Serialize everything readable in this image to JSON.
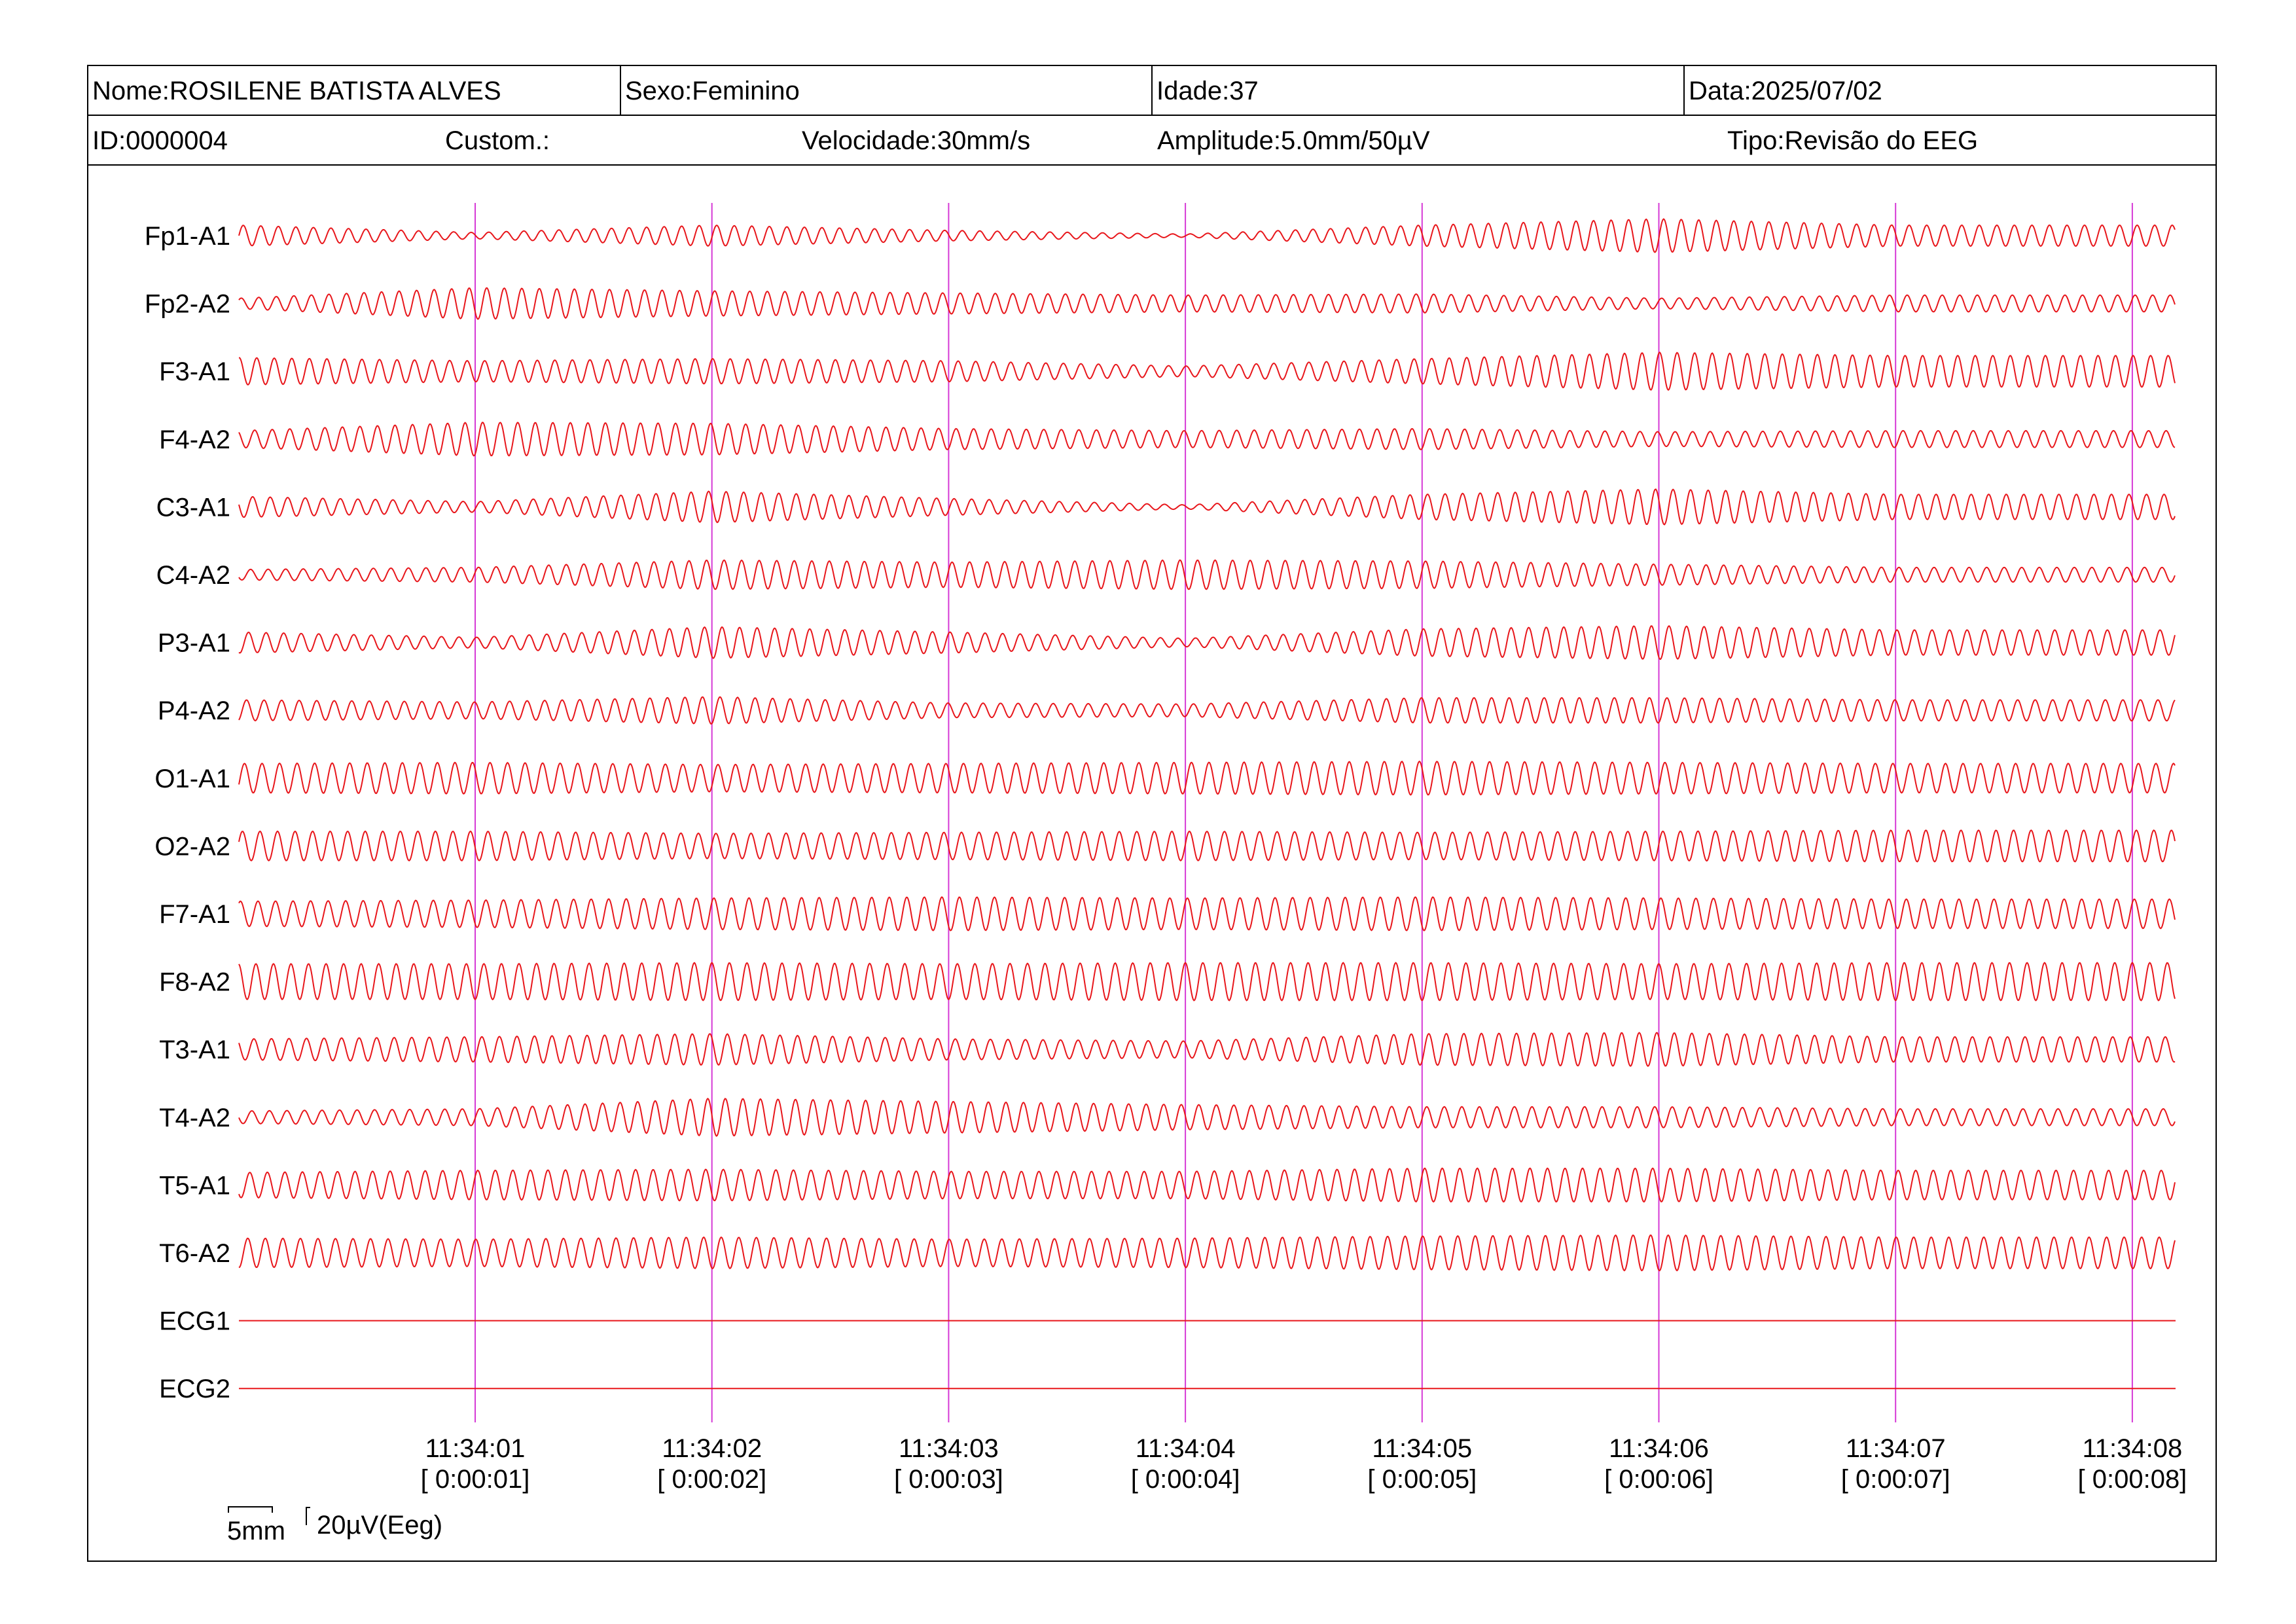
{
  "header": {
    "nome": "Nome:ROSILENE BATISTA ALVES",
    "sexo": "Sexo:Feminino",
    "idade": "Idade:37",
    "data": "Data:2025/07/02",
    "id": "ID:0000004",
    "custom": "Custom.:",
    "velocidade": "Velocidade:30mm/s",
    "amplitude": "Amplitude:5.0mm/50µV",
    "tipo": "Tipo:Revisão do EEG"
  },
  "channels": [
    {
      "label": "Fp1-A1",
      "type": "eeg",
      "env": [
        1.0,
        0.3,
        1.0,
        0.5,
        0.15,
        1.0,
        1.6,
        1.0
      ]
    },
    {
      "label": "Fp2-A2",
      "type": "eeg",
      "env": [
        0.5,
        1.5,
        1.2,
        1.0,
        0.8,
        0.9,
        0.5,
        0.8
      ]
    },
    {
      "label": "F3-A1",
      "type": "eeg",
      "env": [
        1.3,
        1.0,
        1.2,
        1.0,
        0.5,
        1.2,
        1.8,
        1.5
      ]
    },
    {
      "label": "F4-A2",
      "type": "eeg",
      "env": [
        0.8,
        1.6,
        1.5,
        1.0,
        0.8,
        1.0,
        0.7,
        0.8
      ]
    },
    {
      "label": "C3-A1",
      "type": "eeg",
      "env": [
        1.0,
        0.5,
        1.5,
        0.8,
        0.2,
        1.2,
        1.7,
        1.2
      ]
    },
    {
      "label": "C4-A2",
      "type": "eeg",
      "env": [
        0.5,
        0.7,
        1.4,
        1.2,
        1.4,
        1.3,
        1.0,
        0.7
      ]
    },
    {
      "label": "P3-A1",
      "type": "eeg",
      "env": [
        1.0,
        0.5,
        1.5,
        1.0,
        0.4,
        1.3,
        1.6,
        1.2
      ]
    },
    {
      "label": "P4-A2",
      "type": "eeg",
      "env": [
        1.0,
        0.8,
        1.3,
        0.7,
        0.6,
        1.2,
        1.2,
        1.0
      ]
    },
    {
      "label": "O1-A1",
      "type": "eeg",
      "env": [
        1.4,
        1.5,
        1.3,
        1.4,
        1.5,
        1.6,
        1.5,
        1.4
      ]
    },
    {
      "label": "O2-A2",
      "type": "eeg",
      "env": [
        1.4,
        1.4,
        1.2,
        1.3,
        1.4,
        1.3,
        1.4,
        1.5
      ]
    },
    {
      "label": "F7-A1",
      "type": "eeg",
      "env": [
        1.2,
        1.3,
        1.5,
        1.6,
        1.5,
        1.6,
        1.5,
        1.4
      ]
    },
    {
      "label": "F8-A2",
      "type": "eeg",
      "env": [
        1.7,
        1.7,
        1.8,
        1.7,
        1.8,
        1.8,
        1.7,
        1.8
      ]
    },
    {
      "label": "T3-A1",
      "type": "eeg",
      "env": [
        1.0,
        1.2,
        1.5,
        1.0,
        0.8,
        1.5,
        1.6,
        1.2
      ]
    },
    {
      "label": "T4-A2",
      "type": "eeg",
      "env": [
        0.6,
        0.8,
        1.8,
        1.5,
        1.2,
        1.0,
        1.0,
        0.8
      ]
    },
    {
      "label": "T5-A1",
      "type": "eeg",
      "env": [
        1.2,
        1.4,
        1.5,
        1.3,
        1.3,
        1.6,
        1.6,
        1.4
      ]
    },
    {
      "label": "T6-A2",
      "type": "eeg",
      "env": [
        1.4,
        1.3,
        1.5,
        1.3,
        1.4,
        1.6,
        1.7,
        1.5
      ]
    },
    {
      "label": "ECG1",
      "type": "flat"
    },
    {
      "label": "ECG2",
      "type": "flat"
    }
  ],
  "time_marks": [
    {
      "time": "11:34:01",
      "elapsed": "[ 0:00:01]"
    },
    {
      "time": "11:34:02",
      "elapsed": "[ 0:00:02]"
    },
    {
      "time": "11:34:03",
      "elapsed": "[ 0:00:03]"
    },
    {
      "time": "11:34:04",
      "elapsed": "[ 0:00:04]"
    },
    {
      "time": "11:34:05",
      "elapsed": "[ 0:00:05]"
    },
    {
      "time": "11:34:06",
      "elapsed": "[ 0:00:06]"
    },
    {
      "time": "11:34:07",
      "elapsed": "[ 0:00:07]"
    },
    {
      "time": "11:34:08",
      "elapsed": "[ 0:00:08]"
    }
  ],
  "scale": {
    "time_bar": "5mm",
    "amp_label": "20µV(Eeg)"
  },
  "colors": {
    "trace": "#e8161b",
    "marker": "#d63ad6",
    "ink": "#000000"
  },
  "waves_per_second": 13.5
}
